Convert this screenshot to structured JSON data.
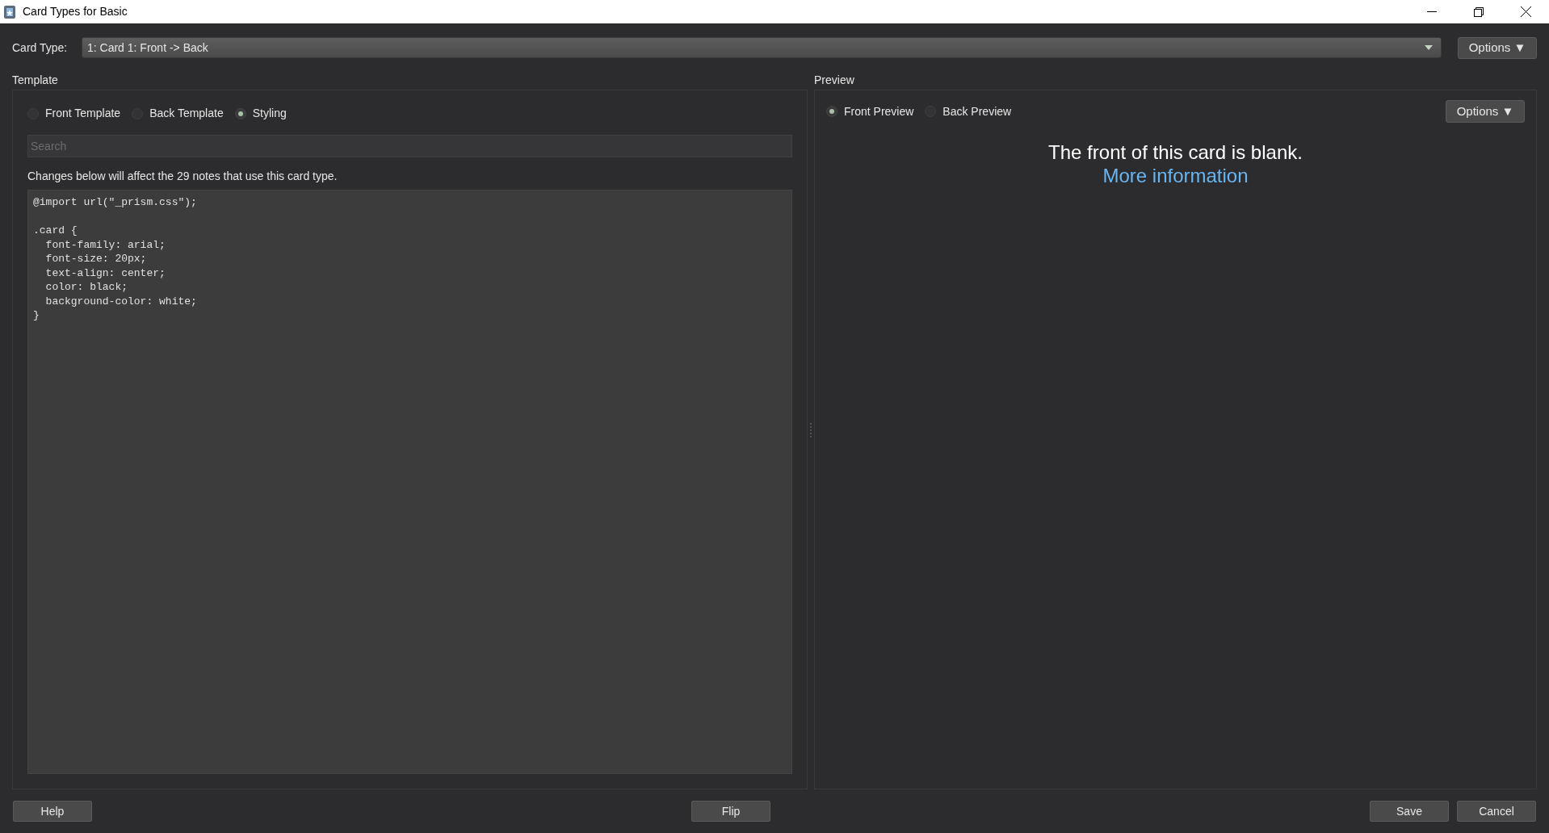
{
  "window": {
    "title": "Card Types for Basic"
  },
  "card_type": {
    "label": "Card Type:",
    "value": "1: Card 1: Front -> Back",
    "options_button": "Options ▼"
  },
  "template": {
    "title": "Template",
    "modes": [
      {
        "label": "Front Template",
        "selected": false
      },
      {
        "label": "Back Template",
        "selected": false
      },
      {
        "label": "Styling",
        "selected": true
      }
    ],
    "search": {
      "placeholder": "Search"
    },
    "notice": "Changes below will affect the 29 notes that use this card type.",
    "code": "@import url(\"_prism.css\");\n\n.card {\n  font-family: arial;\n  font-size: 20px;\n  text-align: center;\n  color: black;\n  background-color: white;\n}"
  },
  "preview": {
    "title": "Preview",
    "modes": [
      {
        "label": "Front Preview",
        "selected": true
      },
      {
        "label": "Back Preview",
        "selected": false
      }
    ],
    "options_button": "Options ▼",
    "message": "The front of this card is blank.",
    "link": "More information"
  },
  "buttons": {
    "help": "Help",
    "flip": "Flip",
    "save": "Save",
    "cancel": "Cancel"
  }
}
